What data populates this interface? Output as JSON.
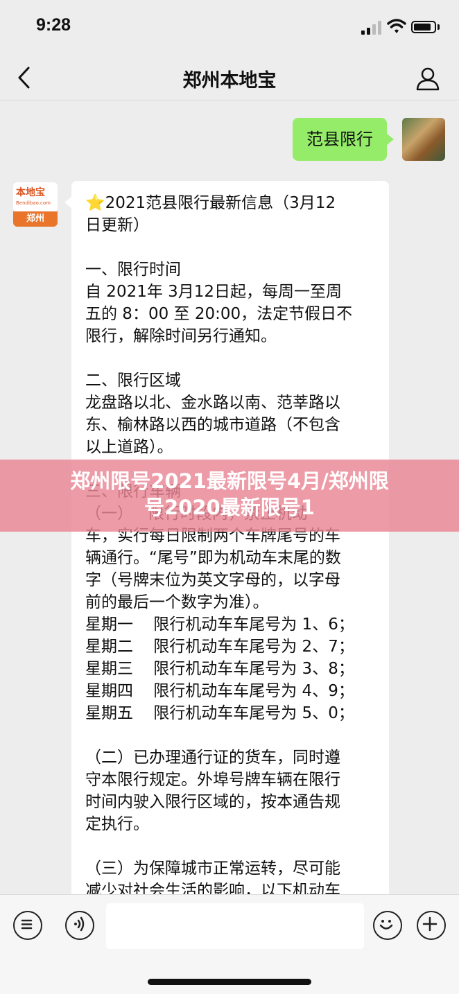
{
  "status_bar": {
    "time": "9:28"
  },
  "nav": {
    "title": "郑州本地宝"
  },
  "chat": {
    "my_message": "范县限行",
    "bot": {
      "brand": "本地宝",
      "url": "Bendibao.com",
      "city": "郑州"
    },
    "bot_message": {
      "star": "⭐",
      "lines": [
        "2021范县限行最新信息（3月12",
        "日更新）",
        "",
        "一、限行时间",
        "自 2021年 3月12日起，每周一至周",
        "五的 8：00 至 20:00，法定节假日不",
        "限行，解除时间另行通知。",
        "",
        "二、限行区域",
        "龙盘路以北、金水路以南、范莘路以",
        "东、榆林路以西的城市道路（不包含",
        "以上道路）。",
        "",
        "三、限行车辆",
        "（一）   限行时段内，禁止机动",
        "车，实行每日限制两个车牌尾号的车",
        "辆通行。“尾号”即为机动车末尾的数",
        "字（号牌末位为英文字母的，以字母",
        "前的最后一个数字为准）。",
        "星期一    限行机动车车尾号为 1、6；",
        "星期二    限行机动车车尾号为 2、7；",
        "星期三    限行机动车车尾号为 3、8；",
        "星期四    限行机动车车尾号为 4、9；",
        "星期五    限行机动车车尾号为 5、0；",
        "",
        "（二）已办理通行证的货车，同时遵",
        "守本限行规定。外埠号牌车辆在限行",
        "时间内驶入限行区域的，按本通告规",
        "定执行。",
        "",
        "（三）为保障城市正常运转，尽可能",
        "减少对社会生活的影响，以下机动车"
      ]
    }
  },
  "banner": {
    "line1": "郑州限号2021最新限号4月/郑州限",
    "line2": "号2020最新限号1"
  },
  "input_bar": {
    "text": ""
  }
}
